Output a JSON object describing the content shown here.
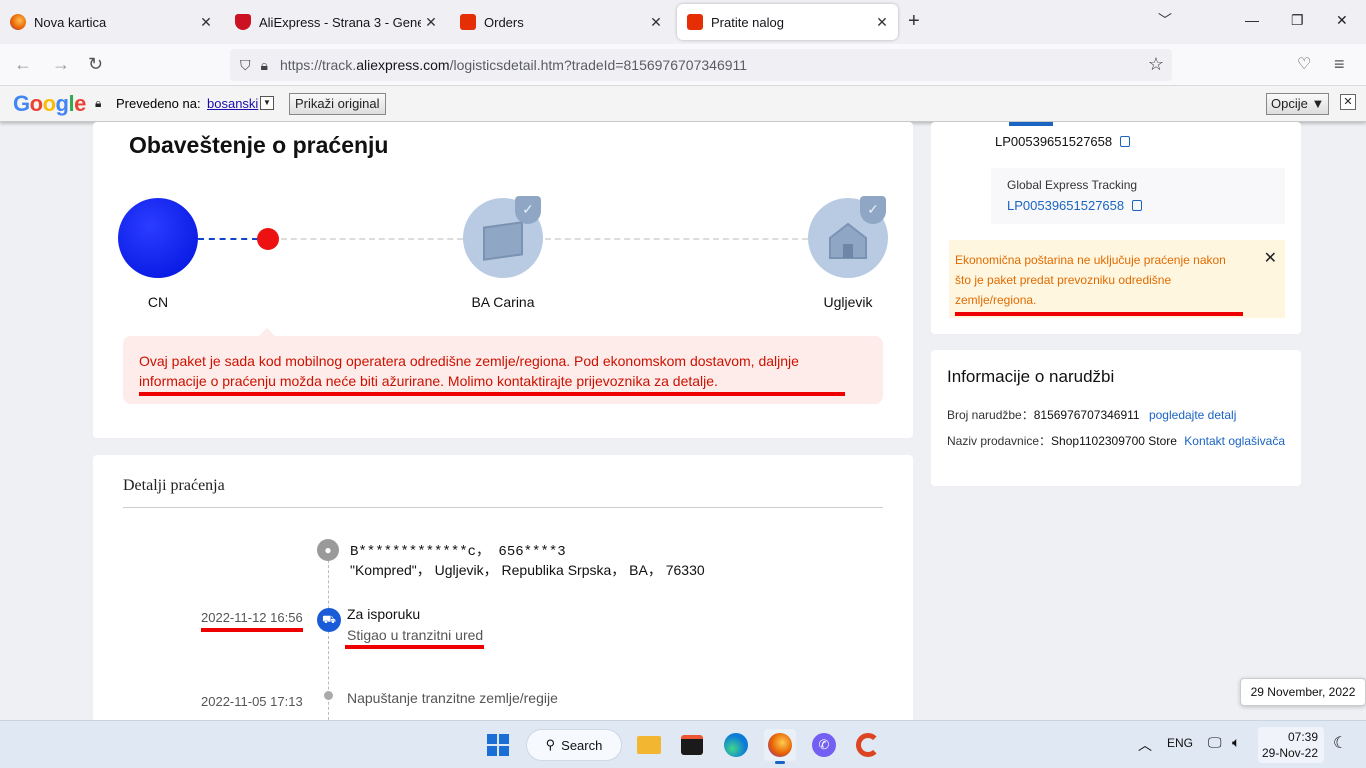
{
  "browser": {
    "tabs": [
      {
        "label": "Nova kartica",
        "color": "#e66000"
      },
      {
        "label": "AliExpress - Strana 3 - Generalno",
        "color": "#cc1122"
      },
      {
        "label": "Orders",
        "color": "#e62e04"
      },
      {
        "label": "Pratite nalog",
        "color": "#e62e04",
        "active": true
      }
    ],
    "url_prefix": "https://track.",
    "url_domain": "aliexpress.com",
    "url_suffix": "/logisticsdetail.htm?tradeId=8156976707346911"
  },
  "translate_bar": {
    "logo": "Google",
    "translated_to_label": "Prevedeno na:",
    "language": "bosanski",
    "show_original": "Prikaži original",
    "options": "Opcije ▼"
  },
  "notice": {
    "title": "Obaveštenje o praćenju",
    "nodes": [
      "CN",
      "BA Carina",
      "Ugljevik"
    ],
    "message": "Ovaj paket je sada kod mobilnog operatera odredišne zemlje/regiona. Pod ekonomskom dostavom, daljnje informacije o praćenju možda neće biti ažurirane. Molimo kontaktirajte prijevoznika za detalje."
  },
  "details": {
    "title": "Detalji praćenja",
    "address_line1": "B*************c， 656****3",
    "address_line2": "\"Kompred\"， Ugljevik， Republika Srpska， BA， 76330",
    "events": [
      {
        "date": "2022-11-12 16:56",
        "status": "Za isporuku",
        "sub": "Stigao u tranzitni ured"
      },
      {
        "date": "2022-11-05 17:13",
        "status": "",
        "sub": "Napuštanje tranzitne zemlje/regije"
      }
    ]
  },
  "side": {
    "tracking_number": "LP00539651527658",
    "global_label": "Global Express Tracking",
    "global_number": "LP00539651527658",
    "alert": "Ekonomična poštarina ne uključuje praćenje nakon što je paket predat prevozniku odredišne zemlje/regiona."
  },
  "order": {
    "title": "Informacije o narudžbi",
    "order_no_label": "Broj narudžbe：",
    "order_no": "8156976707346911",
    "order_link": "pogledajte detalj",
    "store_label": "Naziv prodavnice：",
    "store": "Shop1102309700 Store",
    "store_link_1": "Kontakt",
    "store_link_2": "oglašivača"
  },
  "tooltip_date": "29 November, 2022",
  "taskbar": {
    "search": "Search",
    "lang": "ENG",
    "time": "07:39",
    "date": "29-Nov-22"
  },
  "colors": {
    "accent": "#1a64c2",
    "alert_red": "#cc1100",
    "alert_orange": "#e06b00",
    "underline": "#ee0000"
  }
}
